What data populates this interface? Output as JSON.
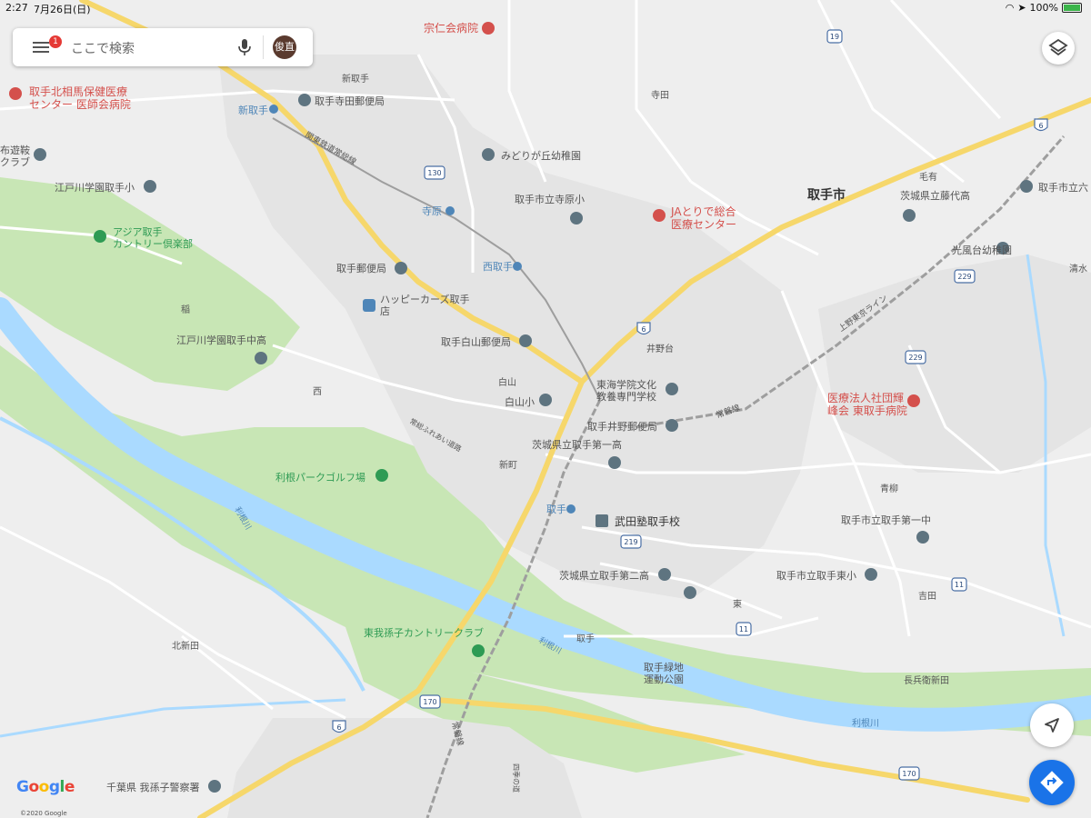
{
  "status_bar": {
    "time": "2:27",
    "date": "7月26日(日)",
    "battery": "100%"
  },
  "search": {
    "placeholder": "ここで検索",
    "menu_badge": "1",
    "avatar_text": "俊直"
  },
  "colors": {
    "water": "#aadaff",
    "park": "#c8e6b5",
    "highway": "#f6d76b",
    "road": "#ffffff",
    "land": "#eeeeee",
    "poi_red": "#d4504c",
    "poi_gray": "#5e7480",
    "poi_blue": "#4f86b8",
    "poi_green": "#2e9b54"
  },
  "places": {
    "souninkai": "宗仁会病院",
    "kitasoma": "取手北相馬保健医療",
    "kitasoma2": "センター 医師会病院",
    "shintoride_area": "新取手",
    "terada_post": "取手寺田郵便局",
    "shintoride_st": "新取手",
    "kantetsu": "関東鉄道常総線",
    "midorigaoka": "みどりが丘幼稚園",
    "club": "布遊鞍",
    "club2": "クラブ",
    "edogawa_elem": "江戸川学園取手小",
    "terahara_elem": "取手市立寺原小",
    "ja_hosp": "JAとりで総合",
    "ja_hosp2": "医療センター",
    "toride_city": "取手市",
    "moari": "毛有",
    "fujishiro_hs": "茨城県立藤代高",
    "roku": "取手市立六",
    "terahara_st": "寺原",
    "asia_cc": "アジア取手",
    "asia_cc2": "カントリー倶楽部",
    "nishitoride_st": "西取手",
    "toride_post": "取手郵便局",
    "happy": "ハッピーカーズ取手",
    "happy2": "店",
    "inagi": "稲",
    "koufudai": "光風台幼稚園",
    "shimizu": "清水",
    "edogawa_jh": "江戸川学園取手中高",
    "shirayama_post": "取手白山郵便局",
    "idodai": "井野台",
    "nishi": "西",
    "shirayama": "白山",
    "shirayama_elem": "白山小",
    "tokai": "東海学院文化",
    "tokai2": "教養専門学校",
    "hospital_east": "医療法人社団輝",
    "hospital_east2": "峰会 東取手病院",
    "ino_post": "取手井野郵便局",
    "hs1": "茨城県立取手第一高",
    "jouban": "常磐線",
    "ueno": "上野東京ライン",
    "fureai": "常総ふれあい道路",
    "shinmachi": "新町",
    "park_golf": "利根パークゴルフ場",
    "aoyagi": "青柳",
    "toride_st": "取手",
    "takeda": "武田塾取手校",
    "jh1": "取手市立取手第一中",
    "tonegawa1": "利根川",
    "hs2": "茨城県立取手第二高",
    "higashi_elem": "取手市立取手東小",
    "yoshida": "吉田",
    "higashi": "東",
    "abiko_cc": "東我孫子カントリークラブ",
    "kitashinden": "北新田",
    "toride_area": "取手",
    "tonegawa2": "利根川",
    "ryokuchi": "取手緑地",
    "ryokuchi2": "運動公園",
    "nagahyoe": "長兵衛新田",
    "tonegawa3": "利根川",
    "joban_v": "常磐線",
    "shikoku": "四季の道",
    "abiko_police": "千葉県 我孫子警察署",
    "terada": "寺田"
  },
  "route_shields": [
    "6",
    "19",
    "130",
    "229",
    "219",
    "11",
    "170"
  ],
  "attribution": {
    "logo": "Google",
    "copyright": "©2020 Google"
  }
}
